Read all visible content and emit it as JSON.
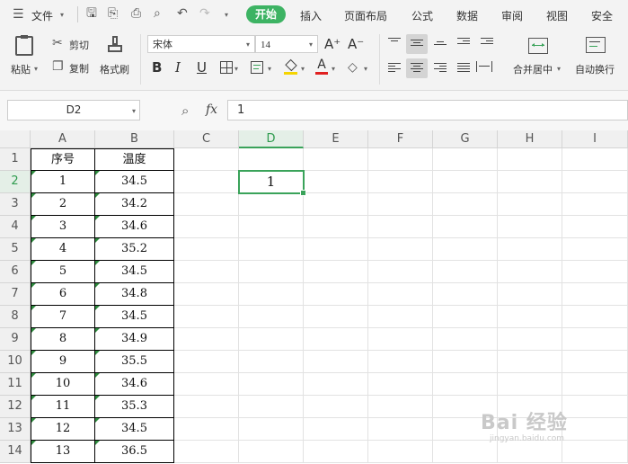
{
  "menu": {
    "file_label": "文件",
    "tabs": [
      "开始",
      "插入",
      "页面布局",
      "公式",
      "数据",
      "审阅",
      "视图",
      "安全"
    ],
    "active_tab": "开始"
  },
  "ribbon": {
    "paste": "粘贴",
    "cut": "剪切",
    "copy": "复制",
    "format_painter": "格式刷",
    "font_name": "宋体",
    "font_size": "14",
    "bold": "B",
    "italic": "I",
    "underline": "U",
    "grow_font": "A⁺",
    "shrink_font": "A⁻",
    "merge_center": "合并居中",
    "wrap_text": "自动换行"
  },
  "formula_bar": {
    "name_box": "D2",
    "fx_label": "fx",
    "value": "1"
  },
  "sheet": {
    "columns": [
      "A",
      "B",
      "C",
      "D",
      "E",
      "F",
      "G",
      "H",
      "I"
    ],
    "selected_column": "D",
    "rows": [
      "1",
      "2",
      "3",
      "4",
      "5",
      "6",
      "7",
      "8",
      "9",
      "10",
      "11",
      "12",
      "13",
      "14"
    ],
    "selected_row": "2",
    "header_row": [
      "序号",
      "温度"
    ],
    "data": [
      [
        "1",
        "34.5"
      ],
      [
        "2",
        "34.2"
      ],
      [
        "3",
        "34.6"
      ],
      [
        "4",
        "35.2"
      ],
      [
        "5",
        "34.5"
      ],
      [
        "6",
        "34.8"
      ],
      [
        "7",
        "34.5"
      ],
      [
        "8",
        "34.9"
      ],
      [
        "9",
        "35.5"
      ],
      [
        "10",
        "34.6"
      ],
      [
        "11",
        "35.3"
      ],
      [
        "12",
        "34.5"
      ],
      [
        "13",
        "36.5"
      ]
    ],
    "active_cell": "D2",
    "active_cell_value": "1"
  },
  "watermark": {
    "text": "Bai 经验",
    "sub": "jingyan.baidu.com"
  }
}
